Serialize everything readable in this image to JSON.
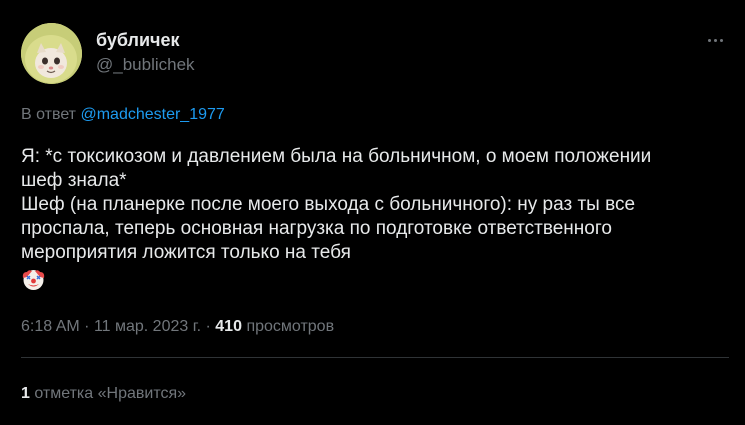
{
  "author": {
    "display_name": "бубличек",
    "handle": "@_bublichek",
    "avatar_icon": "cat-in-hat-avatar"
  },
  "reply": {
    "prefix": "В ответ",
    "to_handle": "@madchester_1977"
  },
  "tweet": {
    "lines": [
      "Я: *с токсикозом и давлением была на больничном, о моем положении",
      "шеф знала*",
      "Шеф (на планерке после моего выхода с больничного): ну раз ты все",
      "проспала, теперь основная нагрузка по подготовке ответственного",
      "мероприятия ложится только на тебя"
    ],
    "emoji": "clown-face-icon"
  },
  "meta": {
    "time": "6:18 AM",
    "separator": "·",
    "date": "11 мар. 2023 г.",
    "views_count": "410",
    "views_label": "просмотров"
  },
  "engagement": {
    "likes_count": "1",
    "likes_label": "отметка «Нравится»"
  },
  "colors": {
    "background": "#000000",
    "text": "#e7e9ea",
    "secondary": "#71767b",
    "link": "#1d9bf0",
    "divider": "#2f3336"
  }
}
